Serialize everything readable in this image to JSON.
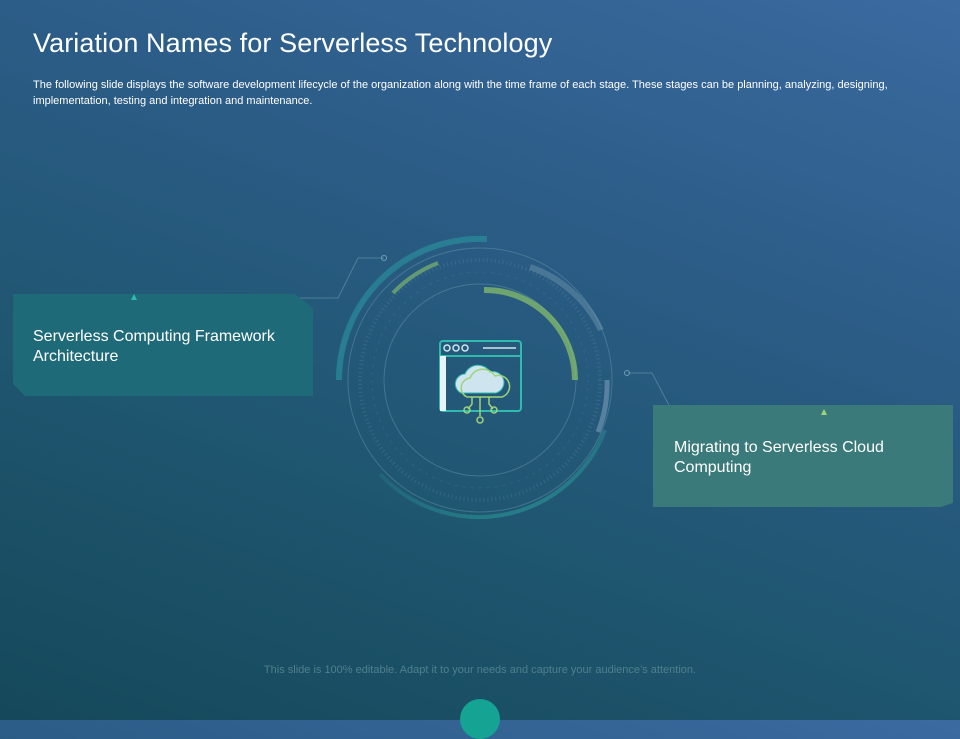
{
  "slide": {
    "title": "Variation Names for Serverless Technology",
    "description": "The following slide displays the software development  lifecycle of the organization along with the time frame of each stage. These stages can be planning, analyzing, designing, implementation, testing and integration and maintenance."
  },
  "boxes": {
    "left_label": "Serverless Computing Framework Architecture",
    "right_label": "Migrating to Serverless Cloud Computing"
  },
  "center_icon": "cloud-computing-window-icon",
  "footer": {
    "note": "This slide is 100% editable. Adapt it to your needs and capture your audience’s attention."
  },
  "colors": {
    "background_top": "#3a6aa0",
    "background_bottom": "#15485a",
    "accent_teal": "#2fbcae",
    "accent_green": "#9ed37a",
    "left_box": "#1f6a78",
    "right_box": "#3a7a7a"
  }
}
